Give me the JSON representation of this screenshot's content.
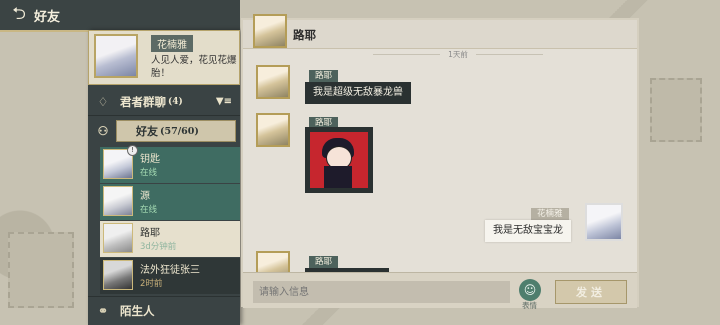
{
  "header": {
    "title": "好友"
  },
  "profile": {
    "name": "花楠雅",
    "signature": "人见人爱，花见花爆胎！"
  },
  "sections": {
    "group_chat": {
      "label": "君者群聊",
      "count": "(4)"
    },
    "friends": {
      "label": "好友",
      "count": "(57/60)"
    },
    "strangers": {
      "label": "陌生人"
    }
  },
  "friends": [
    {
      "name": "钥匙",
      "status": "在线"
    },
    {
      "name": "源",
      "status": "在线"
    },
    {
      "name": "路耶",
      "status": "3d分钟前"
    },
    {
      "name": "法外狂徒张三",
      "status": "2时前"
    }
  ],
  "chat": {
    "contact_name": "路耶",
    "time_divider": "1天前",
    "messages": [
      {
        "sender": "路耶",
        "text": "我是超级无敌暴龙兽"
      },
      {
        "sender": "路耶",
        "type": "sticker"
      },
      {
        "sender": "花楠雅",
        "text": "我是无敌宝宝龙"
      },
      {
        "sender": "路耶",
        "text": ""
      }
    ]
  },
  "input": {
    "placeholder": "请输入信息",
    "emoji_label": "表情",
    "send_label": "发送"
  },
  "icons": {
    "back": "back-arrow-icon",
    "group": "group-chat-icon",
    "friends": "friends-icon",
    "stranger": "stranger-icon",
    "filter": "filter-icon",
    "emoji": "emoji-icon"
  },
  "colors": {
    "panel_dark": "#3a4344",
    "teal": "#3f6c62",
    "gold": "#b49d58",
    "chat_bg": "#e4e0d7"
  }
}
